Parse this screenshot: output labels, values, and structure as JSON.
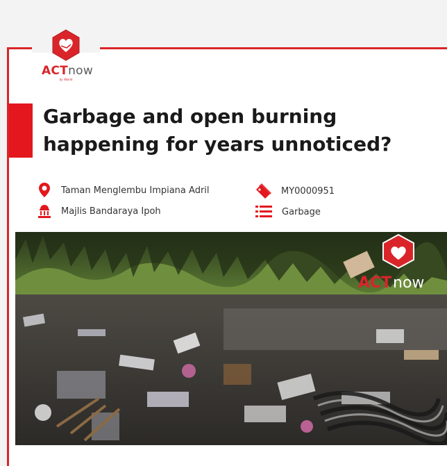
{
  "brand": {
    "act": "ACT",
    "now": "now",
    "tagline": "by iWorld"
  },
  "report": {
    "title": "Garbage and open burning happening for years unnoticed?",
    "location": "Taman Menglembu Impiana Adril",
    "council": "Majlis Bandaraya Ipoh",
    "report_id": "MY0000951",
    "category": "Garbage"
  },
  "photo": {
    "watermark_act": "ACT",
    "watermark_now": "now"
  },
  "colors": {
    "accent": "#d9252a",
    "title": "#1a1a1a",
    "text": "#333333"
  },
  "icons": [
    "location-pin-icon",
    "council-building-icon",
    "tag-icon",
    "list-icon",
    "heart-hand-icon"
  ]
}
